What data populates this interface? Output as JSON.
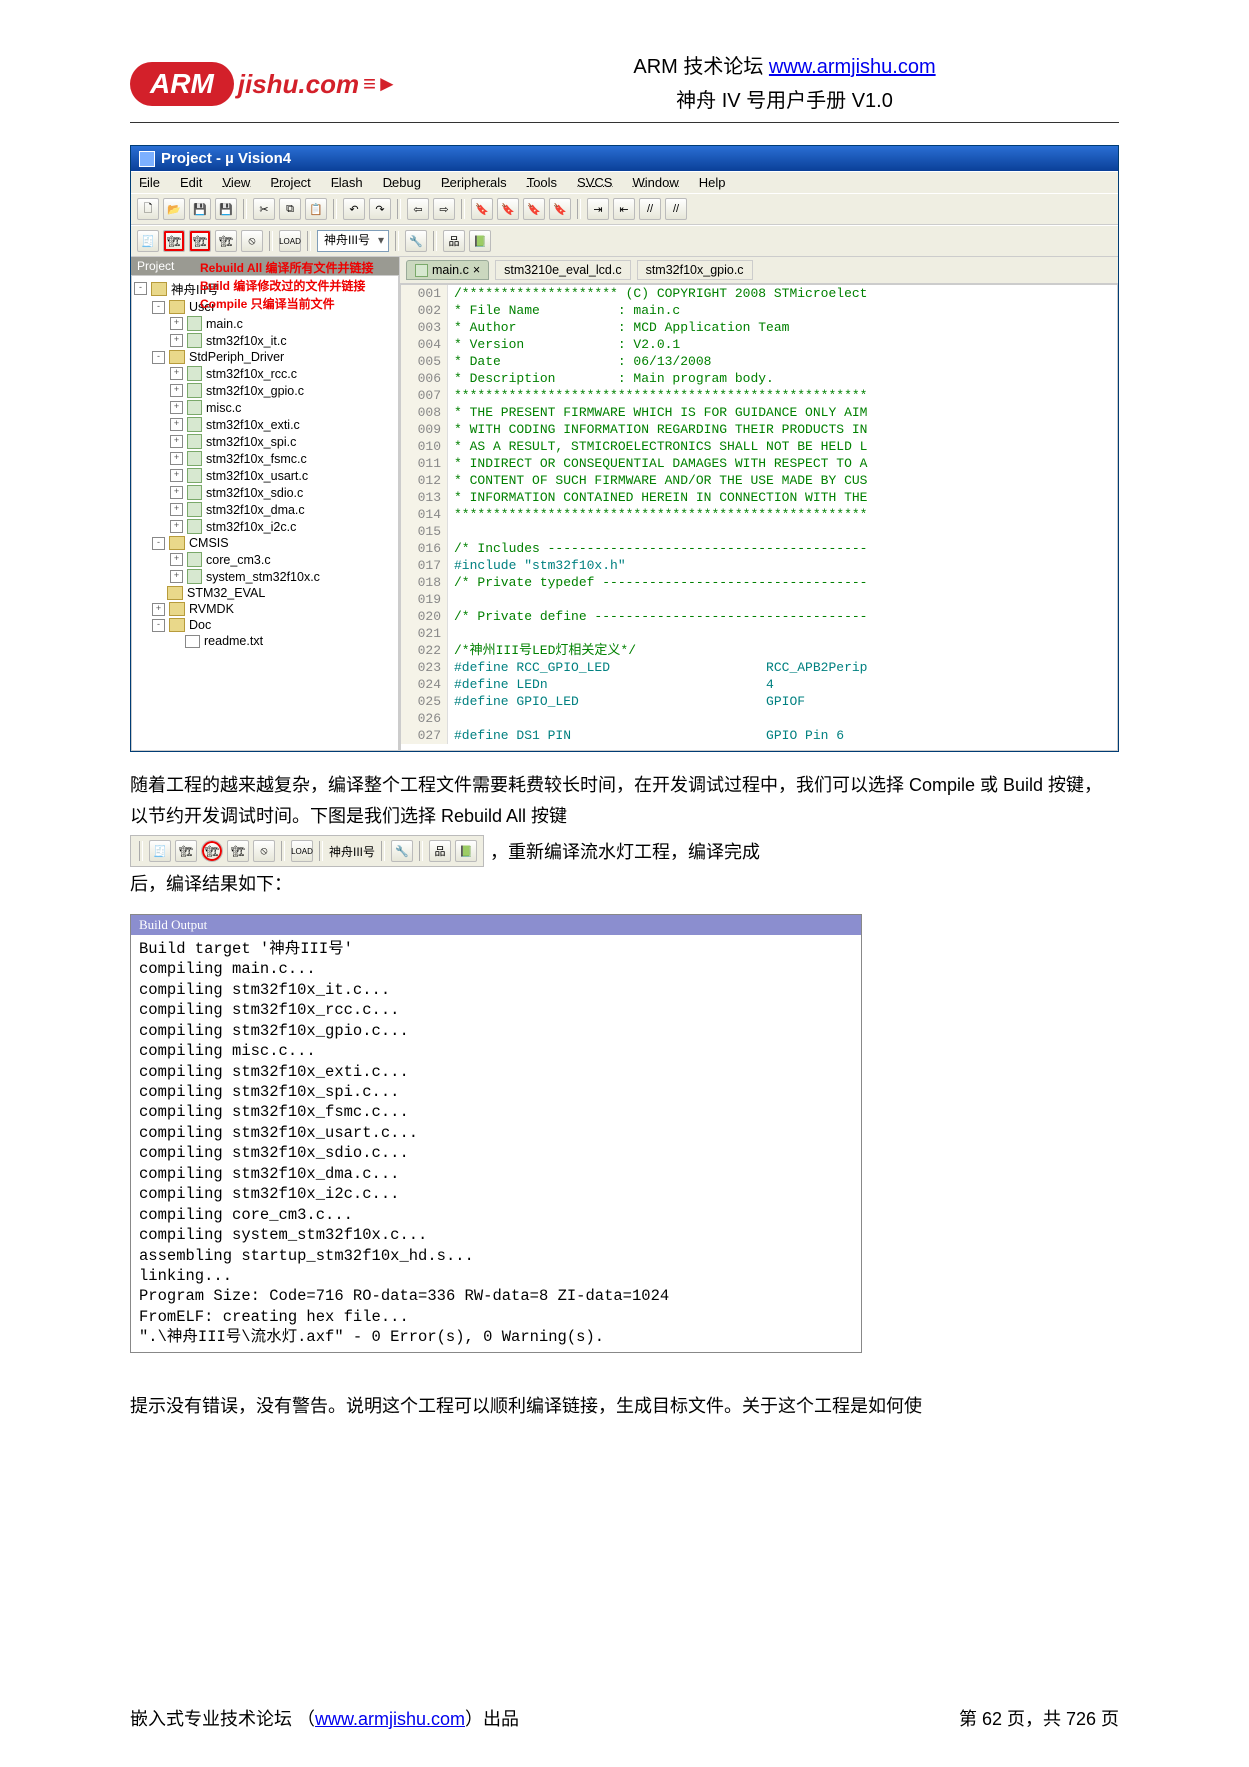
{
  "header": {
    "forum_label": "ARM 技术论坛 ",
    "forum_url": "www.armjishu.com",
    "manual_title": "神舟 IV 号用户手册  V1.0",
    "logo_main": "ARM",
    "logo_tail": "jishu.com"
  },
  "uv": {
    "title": "Project   -  µ Vision4",
    "menu": [
      "File",
      "Edit",
      "View",
      "Project",
      "Flash",
      "Debug",
      "Peripherals",
      "Tools",
      "SVCS",
      "Window",
      "Help"
    ],
    "combo_target": "神舟III号",
    "sidebar_title": "Project",
    "tree": {
      "root": "神舟III号",
      "user_folder": "User",
      "user_files": [
        "main.c",
        "stm32f10x_it.c"
      ],
      "driver_folder": "StdPeriph_Driver",
      "driver_files": [
        "stm32f10x_rcc.c",
        "stm32f10x_gpio.c",
        "misc.c",
        "stm32f10x_exti.c",
        "stm32f10x_spi.c",
        "stm32f10x_fsmc.c",
        "stm32f10x_usart.c",
        "stm32f10x_sdio.c",
        "stm32f10x_dma.c",
        "stm32f10x_i2c.c"
      ],
      "cmsis_folder": "CMSIS",
      "cmsis_files": [
        "core_cm3.c",
        "system_stm32f10x.c"
      ],
      "stm32_eval_folder": "STM32_EVAL",
      "rvmdk_folder": "RVMDK",
      "doc_folder": "Doc",
      "doc_files": [
        "readme.txt"
      ]
    },
    "annotations": {
      "rebuild": "Rebuild All 编译所有文件并链接",
      "build": "Build  编译修改过的文件并链接",
      "compile": "Compile 只编译当前文件"
    },
    "tabs": {
      "active": "main.c",
      "t2": "stm3210e_eval_lcd.c",
      "t3": "stm32f10x_gpio.c"
    },
    "editor_lines": [
      {
        "n": "001",
        "t": "/******************** (C) COPYRIGHT 2008 STMicroelect",
        "c": "cm"
      },
      {
        "n": "002",
        "t": "* File Name          : main.c",
        "c": "cm"
      },
      {
        "n": "003",
        "t": "* Author             : MCD Application Team",
        "c": "cm"
      },
      {
        "n": "004",
        "t": "* Version            : V2.0.1",
        "c": "cm"
      },
      {
        "n": "005",
        "t": "* Date               : 06/13/2008",
        "c": "cm"
      },
      {
        "n": "006",
        "t": "* Description        : Main program body.",
        "c": "cm"
      },
      {
        "n": "007",
        "t": "*****************************************************",
        "c": "cm"
      },
      {
        "n": "008",
        "t": "* THE PRESENT FIRMWARE WHICH IS FOR GUIDANCE ONLY AIM",
        "c": "cm"
      },
      {
        "n": "009",
        "t": "* WITH CODING INFORMATION REGARDING THEIR PRODUCTS IN",
        "c": "cm"
      },
      {
        "n": "010",
        "t": "* AS A RESULT, STMICROELECTRONICS SHALL NOT BE HELD L",
        "c": "cm"
      },
      {
        "n": "011",
        "t": "* INDIRECT OR CONSEQUENTIAL DAMAGES WITH RESPECT TO A",
        "c": "cm"
      },
      {
        "n": "012",
        "t": "* CONTENT OF SUCH FIRMWARE AND/OR THE USE MADE BY CUS",
        "c": "cm"
      },
      {
        "n": "013",
        "t": "* INFORMATION CONTAINED HEREIN IN CONNECTION WITH THE",
        "c": "cm"
      },
      {
        "n": "014",
        "t": "*****************************************************",
        "c": "cm"
      },
      {
        "n": "015",
        "t": "",
        "c": ""
      },
      {
        "n": "016",
        "t": "/* Includes -----------------------------------------",
        "c": "cm"
      },
      {
        "n": "017",
        "t": "#include \"stm32f10x.h\"",
        "c": "pp"
      },
      {
        "n": "018",
        "t": "/* Private typedef ----------------------------------",
        "c": "cm"
      },
      {
        "n": "019",
        "t": "",
        "c": ""
      },
      {
        "n": "020",
        "t": "/* Private define -----------------------------------",
        "c": "cm"
      },
      {
        "n": "021",
        "t": "",
        "c": ""
      },
      {
        "n": "022",
        "t": "/*神州III号LED灯相关定义*/",
        "c": "cm"
      },
      {
        "n": "023",
        "t": "#define RCC_GPIO_LED                    RCC_APB2Perip",
        "c": "pp"
      },
      {
        "n": "024",
        "t": "#define LEDn                            4",
        "c": "pp"
      },
      {
        "n": "025",
        "t": "#define GPIO_LED                        GPIOF",
        "c": "pp"
      },
      {
        "n": "026",
        "t": "",
        "c": ""
      },
      {
        "n": "027",
        "t": "#define DS1 PIN                         GPIO Pin 6",
        "c": "pp"
      }
    ]
  },
  "para1": "随着工程的越来越复杂，编译整个工程文件需要耗费较长时间，在开发调试过程中，我们可以选择 Compile 或 Build 按键，以节约开发调试时间。下图是我们选择 Rebuild All 按键",
  "toolbar_strip_combo": "神舟III号",
  "after_strip": "，重新编译流水灯工程，编译完成",
  "para2": "后，编译结果如下：",
  "build_output": {
    "title": "Build Output",
    "lines": [
      "Build target '神舟III号'",
      "compiling main.c...",
      "compiling stm32f10x_it.c...",
      "compiling stm32f10x_rcc.c...",
      "compiling stm32f10x_gpio.c...",
      "compiling misc.c...",
      "compiling stm32f10x_exti.c...",
      "compiling stm32f10x_spi.c...",
      "compiling stm32f10x_fsmc.c...",
      "compiling stm32f10x_usart.c...",
      "compiling stm32f10x_sdio.c...",
      "compiling stm32f10x_dma.c...",
      "compiling stm32f10x_i2c.c...",
      "compiling core_cm3.c...",
      "compiling system_stm32f10x.c...",
      "assembling startup_stm32f10x_hd.s...",
      "linking...",
      "Program Size: Code=716 RO-data=336 RW-data=8 ZI-data=1024",
      "FromELF: creating hex file...",
      "\".\\神舟III号\\流水灯.axf\" - 0 Error(s), 0 Warning(s)."
    ]
  },
  "para3": "提示没有错误，没有警告。说明这个工程可以顺利编译链接，生成目标文件。关于这个工程是如何使",
  "footer": {
    "left_a": "嵌入式专业技术论坛 （",
    "link": "www.armjishu.com",
    "left_b": "）出品",
    "right": "第 62 页，共 726 页"
  }
}
